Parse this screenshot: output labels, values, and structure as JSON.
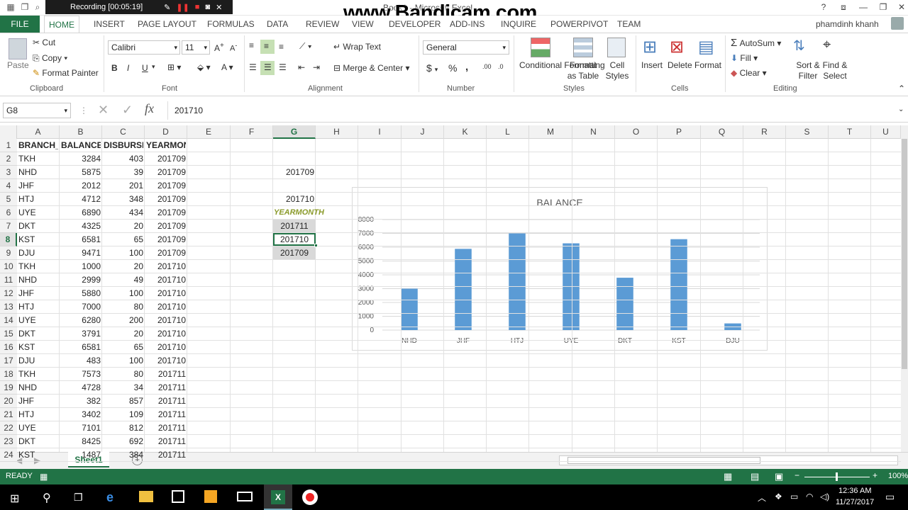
{
  "titlebar": {
    "recording": "Recording [00:05:19]",
    "doc_title": "Book1 - Microsoft Excel",
    "watermark": "www.Bandicam.com"
  },
  "tabs": [
    "FILE",
    "HOME",
    "INSERT",
    "PAGE LAYOUT",
    "FORMULAS",
    "DATA",
    "REVIEW",
    "VIEW",
    "DEVELOPER",
    "ADD-INS",
    "INQUIRE",
    "POWERPIVOT",
    "TEAM"
  ],
  "user": "phamdinh khanh",
  "ribbon": {
    "clipboard": {
      "paste": "Paste",
      "cut": "Cut",
      "copy": "Copy",
      "format_painter": "Format Painter",
      "label": "Clipboard"
    },
    "font": {
      "name": "Calibri",
      "size": "11",
      "label": "Font",
      "bold": "B",
      "italic": "I",
      "underline": "U"
    },
    "alignment": {
      "wrap": "Wrap Text",
      "merge": "Merge & Center",
      "label": "Alignment"
    },
    "number": {
      "format": "General",
      "label": "Number",
      "currency": "$",
      "percent": "%",
      "comma": ","
    },
    "styles": {
      "conditional": "Conditional Formatting",
      "format_table": "Format as Table",
      "cell_styles": "Cell Styles",
      "label": "Styles"
    },
    "cells": {
      "insert": "Insert",
      "delete": "Delete",
      "format": "Format",
      "label": "Cells"
    },
    "editing": {
      "autosum": "AutoSum",
      "fill": "Fill",
      "clear": "Clear",
      "sort": "Sort & Filter",
      "find": "Find & Select",
      "label": "Editing"
    }
  },
  "formula_bar": {
    "name_box": "G8",
    "value": "201710"
  },
  "columns": [
    "A",
    "B",
    "C",
    "D",
    "E",
    "F",
    "G",
    "H",
    "I",
    "J",
    "K",
    "L",
    "M",
    "N",
    "O",
    "P",
    "Q",
    "R",
    "S",
    "T",
    "U"
  ],
  "rows": [
    [
      "BRANCH_I",
      "BALANCE",
      "DISBURSE",
      "YEARMONTH"
    ],
    [
      "TKH",
      "3284",
      "403",
      "201709"
    ],
    [
      "NHD",
      "5875",
      "39",
      "201709"
    ],
    [
      "JHF",
      "2012",
      "201",
      "201709"
    ],
    [
      "HTJ",
      "4712",
      "348",
      "201709"
    ],
    [
      "UYE",
      "6890",
      "434",
      "201709"
    ],
    [
      "DKT",
      "4325",
      "20",
      "201709"
    ],
    [
      "KST",
      "6581",
      "65",
      "201709"
    ],
    [
      "DJU",
      "9471",
      "100",
      "201709"
    ],
    [
      "TKH",
      "1000",
      "20",
      "201710"
    ],
    [
      "NHD",
      "2999",
      "49",
      "201710"
    ],
    [
      "JHF",
      "5880",
      "100",
      "201710"
    ],
    [
      "HTJ",
      "7000",
      "80",
      "201710"
    ],
    [
      "UYE",
      "6280",
      "200",
      "201710"
    ],
    [
      "DKT",
      "3791",
      "20",
      "201710"
    ],
    [
      "KST",
      "6581",
      "65",
      "201710"
    ],
    [
      "DJU",
      "483",
      "100",
      "201710"
    ],
    [
      "TKH",
      "7573",
      "80",
      "201711"
    ],
    [
      "NHD",
      "4728",
      "34",
      "201711"
    ],
    [
      "JHF",
      "382",
      "857",
      "201711"
    ],
    [
      "HTJ",
      "3402",
      "109",
      "201711"
    ],
    [
      "UYE",
      "7101",
      "812",
      "201711"
    ],
    [
      "DKT",
      "8425",
      "692",
      "201711"
    ],
    [
      "KST",
      "1487",
      "384",
      "201711"
    ]
  ],
  "row_numbers": [
    "1",
    "2",
    "3",
    "4",
    "5",
    "6",
    "7",
    "8",
    "9",
    "10",
    "11",
    "12",
    "13",
    "14",
    "15",
    "16",
    "17",
    "18",
    "19",
    "20",
    "21",
    "22",
    "23",
    "24"
  ],
  "g_cells": {
    "g3": "201709",
    "g5": "201710"
  },
  "slicer": {
    "title": "YEARMONTH",
    "items": [
      "201711",
      "201710",
      "201709"
    ],
    "selected": "201710"
  },
  "chart_data": {
    "type": "bar",
    "title": "BALANCE",
    "categories": [
      "NHD",
      "JHF",
      "HTJ",
      "UYE",
      "DKT",
      "KST",
      "DJU"
    ],
    "values": [
      2999,
      5880,
      7000,
      6280,
      3791,
      6581,
      483
    ],
    "ylim": [
      0,
      8000
    ],
    "yticks": [
      "0",
      "1000",
      "2000",
      "3000",
      "4000",
      "5000",
      "6000",
      "7000",
      "8000"
    ],
    "bar_color": "#5b9bd5",
    "grid": true
  },
  "sheet_tab": "Sheet1",
  "status": {
    "ready": "READY",
    "zoom": "100%"
  },
  "taskbar": {
    "time": "12:36 AM",
    "date": "11/27/2017"
  },
  "colors": {
    "accent": "#217346"
  }
}
